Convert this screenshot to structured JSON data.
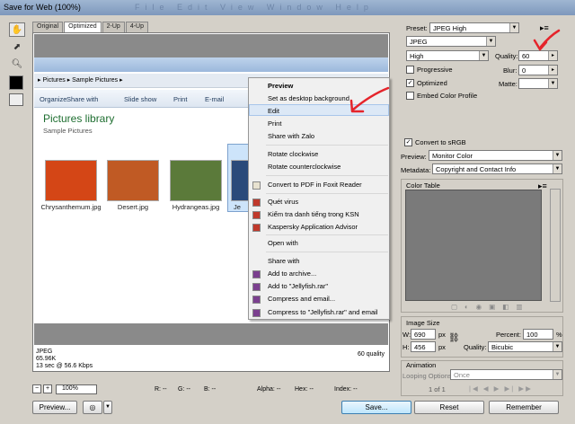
{
  "window": {
    "title": "Save for Web (100%)",
    "menu_ghost": "File  Edit  View  Window  Help"
  },
  "tabs": [
    "Original",
    "Optimized",
    "2-Up",
    "4-Up"
  ],
  "explorer": {
    "breadcrumb": [
      "Pictures",
      "Sample Pictures"
    ],
    "commands": [
      "Organize",
      "Share with",
      "Slide show",
      "Print",
      "E-mail"
    ],
    "library_title": "Pictures library",
    "library_sub": "Sample Pictures",
    "thumbnails": [
      {
        "caption": "Chrysanthemum.jpg",
        "color": "#d44616"
      },
      {
        "caption": "Desert.jpg",
        "color": "#c05a24"
      },
      {
        "caption": "Hydrangeas.jpg",
        "color": "#5b7a3a"
      },
      {
        "caption": "Je",
        "color": "#2a4a7a"
      }
    ]
  },
  "context_menu": [
    {
      "label": "Preview",
      "bold": true
    },
    {
      "label": "Set as desktop background"
    },
    {
      "label": "Edit"
    },
    {
      "label": "Print"
    },
    {
      "label": "Share with Zalo"
    },
    {
      "label": "Rotate clockwise"
    },
    {
      "label": "Rotate counterclockwise"
    },
    {
      "label": "Convert to PDF in Foxit Reader"
    },
    {
      "label": "Quét virus"
    },
    {
      "label": "Kiểm tra danh tiếng trong KSN"
    },
    {
      "label": "Kaspersky Application Advisor"
    },
    {
      "label": "Open with"
    },
    {
      "label": "Share with"
    },
    {
      "label": "Add to archive..."
    },
    {
      "label": "Add to \"Jellyfish.rar\""
    },
    {
      "label": "Compress and email..."
    },
    {
      "label": "Compress to \"Jellyfish.rar\" and email"
    }
  ],
  "info": {
    "format": "JPEG",
    "size": "65.96K",
    "time": "13 sec @ 56.6 Kbps",
    "quality": "60 quality"
  },
  "settings": {
    "preset_label": "Preset:",
    "preset_value": "JPEG High",
    "format_value": "JPEG",
    "compression_value": "High",
    "quality_label": "Quality:",
    "quality_value": "60",
    "blur_label": "Blur:",
    "blur_value": "0",
    "matte_label": "Matte:",
    "progressive": "Progressive",
    "optimized": "Optimized",
    "embed_profile": "Embed Color Profile",
    "convert_srgb": "Convert to sRGB",
    "preview_label": "Preview:",
    "preview_value": "Monitor Color",
    "metadata_label": "Metadata:",
    "metadata_value": "Copyright and Contact Info",
    "color_table": "Color Table",
    "image_size": "Image Size",
    "w_label": "W:",
    "w_value": "690",
    "h_label": "H:",
    "h_value": "456",
    "px": "px",
    "percent_label": "Percent:",
    "percent_value": "100",
    "pct": "%",
    "quality2_label": "Quality:",
    "resample_value": "Bicubic",
    "animation": "Animation",
    "looping_label": "Looping Options:",
    "looping_value": "Once",
    "frame_counter": "1 of 1"
  },
  "status": {
    "zoom": "100%",
    "r": "R: --",
    "g": "G: --",
    "b": "B: --",
    "alpha": "Alpha: --",
    "hex": "Hex: --",
    "index": "Index: --"
  },
  "buttons": {
    "preview": "Preview...",
    "save": "Save...",
    "reset": "Reset",
    "remember": "Remember"
  },
  "annotation_color": "#e5242b"
}
